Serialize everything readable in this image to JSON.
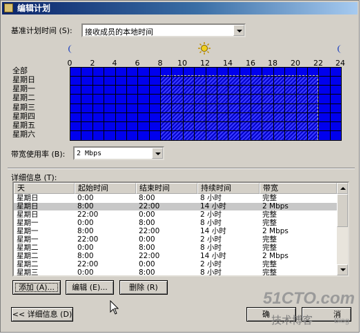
{
  "window": {
    "title": "编辑计划"
  },
  "baseline": {
    "label": "基准计划时间 (S):",
    "value": "接收成员的本地时间"
  },
  "schedule": {
    "hours": [
      "0",
      "2",
      "4",
      "6",
      "8",
      "10",
      "12",
      "14",
      "16",
      "18",
      "20",
      "22",
      "24"
    ],
    "days": [
      "全部",
      "星期日",
      "星期一",
      "星期二",
      "星期三",
      "星期四",
      "星期五",
      "星期六"
    ],
    "night_icon": "moon-icon",
    "day_icon": "sun-icon",
    "cell_color": "#0000ee"
  },
  "bandwidth": {
    "label": "带宽使用率 (B):",
    "value": "2 Mbps"
  },
  "details": {
    "label": "详细信息 (T):",
    "columns": [
      "天",
      "起始时间",
      "结束时间",
      "持续时间",
      "带宽"
    ],
    "rows": [
      [
        "星期日",
        "0:00",
        "8:00",
        "8 小时",
        "完整"
      ],
      [
        "星期日",
        "8:00",
        "22:00",
        "14 小时",
        "2 Mbps"
      ],
      [
        "星期日",
        "22:00",
        "0:00",
        "2 小时",
        "完整"
      ],
      [
        "星期一",
        "0:00",
        "8:00",
        "8 小时",
        "完整"
      ],
      [
        "星期一",
        "8:00",
        "22:00",
        "14 小时",
        "2 Mbps"
      ],
      [
        "星期一",
        "22:00",
        "0:00",
        "2 小时",
        "完整"
      ],
      [
        "星期二",
        "0:00",
        "8:00",
        "8 小时",
        "完整"
      ],
      [
        "星期二",
        "8:00",
        "22:00",
        "14 小时",
        "2 Mbps"
      ],
      [
        "星期二",
        "22:00",
        "0:00",
        "2 小时",
        "完整"
      ],
      [
        "星期三",
        "0:00",
        "8:00",
        "8 小时",
        "完整"
      ]
    ]
  },
  "buttons": {
    "add": "添加 (A)...",
    "edit": "编辑 (E)...",
    "delete": "删除 (R)",
    "details_toggle": "<< 详细信息 (D)",
    "ok": "确",
    "cancel": "消"
  },
  "watermark": {
    "site": "51CTO.com",
    "sub": "技术博客",
    "blog": "Blog"
  }
}
